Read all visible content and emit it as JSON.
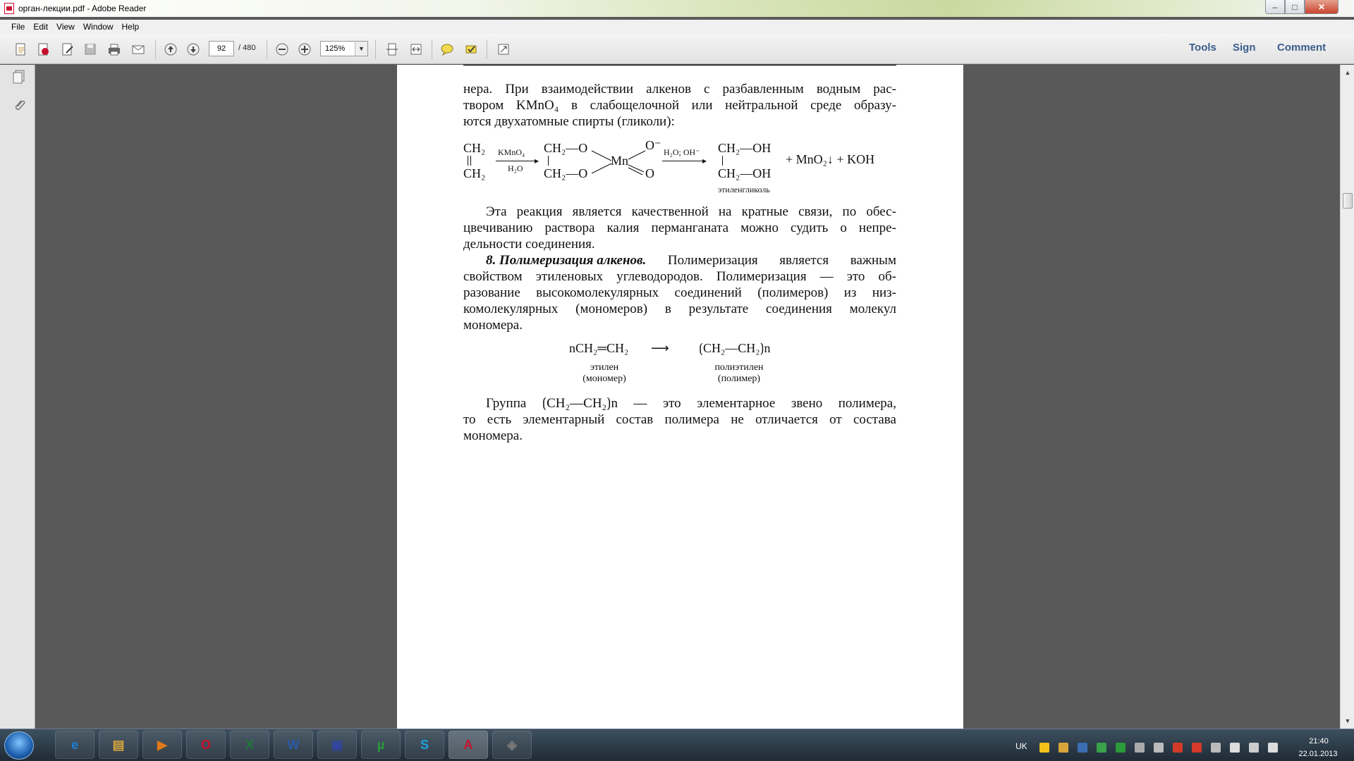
{
  "window": {
    "title": "орган-лекции.pdf - Adobe Reader",
    "minimize": "–",
    "maximize": "□",
    "close": "✕"
  },
  "menu": [
    "File",
    "Edit",
    "View",
    "Window",
    "Help"
  ],
  "toolbar": {
    "page_current": "92",
    "page_total": "/ 480",
    "zoom": "125%",
    "zoom_arrow": "▼",
    "right_buttons": [
      "Tools",
      "Sign",
      "Comment"
    ],
    "icons": [
      "open-icon",
      "create-pdf-icon",
      "edit-icon",
      "save-icon",
      "print-icon",
      "email-icon",
      "page-up-icon",
      "page-down-icon",
      "zoom-out-icon",
      "zoom-in-icon",
      "fit-page-icon",
      "fit-width-icon",
      "comment-icon",
      "highlight-icon",
      "read-mode-icon"
    ]
  },
  "leftpane": {
    "icons": [
      "pages-icon",
      "attachments-icon"
    ]
  },
  "document": {
    "para1": [
      [
        "нера.",
        "При",
        "взаимодействии",
        "алкенов",
        "с",
        "разбавленным",
        "водным",
        "рас-"
      ],
      [
        "твором",
        "KMnO₄",
        "в",
        "слабощелочной",
        "или",
        "нейтральной",
        "среде",
        "образу-"
      ]
    ],
    "para1_last": "ются двухатомные спирты (гликоли):",
    "reaction1": {
      "reactant_top": "CH₂",
      "reactant_bottom": "CH₂",
      "arrow1_top": "KMnO₄",
      "arrow1_bottom": "H₂O",
      "int_top": "CH₂—O",
      "int_bottom": "CH₂—O",
      "mn": "Mn",
      "o_minus": "O⁻",
      "o_double": "O",
      "arrow2_top": "H₂O; OH⁻",
      "prod_top": "CH₂—OH",
      "prod_bottom": "CH₂—OH",
      "byproducts": "+ MnO₂↓ + KOH",
      "prod_label": "этиленгликоль"
    },
    "para2": [
      [
        "Эта",
        "реакция",
        "является",
        "качественной",
        "на",
        "кратные",
        "связи,",
        "по",
        "обес-"
      ],
      [
        "цвечиванию",
        "раствора",
        "калия",
        "перманганата",
        "можно",
        "судить",
        "о",
        "непре-"
      ]
    ],
    "para2_last": "дельности соединения.",
    "para3_heading": "8. Полимеризация алкенов.",
    "para3_first_rest": [
      "Полимеризация",
      "является",
      "важным"
    ],
    "para3": [
      [
        "свойством",
        "этиленовых",
        "углеводородов.",
        "Полимеризация",
        "—",
        "это",
        "об-"
      ],
      [
        "разование",
        "высокомолекулярных",
        "соединений",
        "(полимеров)",
        "из",
        "низ-"
      ],
      [
        "комолекулярных",
        "(мономеров)",
        "в",
        "результате",
        "соединения",
        "молекул"
      ]
    ],
    "para3_last": "мономера.",
    "reaction2": {
      "left": "nCH₂═CH₂",
      "arrow": "⟶",
      "right": "⟮CH₂—CH₂⟯n",
      "left_label1": "этилен",
      "left_label2": "(мономер)",
      "right_label1": "полиэтилен",
      "right_label2": "(полимер)"
    },
    "para4_first": [
      "Группа",
      "⟮CH₂—CH₂⟯n",
      "—",
      "это",
      "элементарное",
      "звено",
      "полимера,"
    ],
    "para4": [
      [
        "то",
        "есть",
        "элементарный",
        "состав",
        "полимера",
        "не",
        "отличается",
        "от",
        "состава"
      ]
    ],
    "para4_last": "мономера."
  },
  "taskbar": {
    "apps": [
      "ie-icon",
      "explorer-icon",
      "media-player-icon",
      "opera-icon",
      "excel-icon",
      "word-icon",
      "save-disk-icon",
      "utorrent-icon",
      "skype-icon",
      "adobe-reader-icon",
      "drive-icon"
    ],
    "app_glyphs": [
      "e",
      "▤",
      "▶",
      "O",
      "X",
      "W",
      "▣",
      "µ",
      "S",
      "A",
      "◈"
    ],
    "lang": "UK",
    "time": "21:40",
    "date": "22.01.2013"
  },
  "colors": {
    "accent": "#3a5c8c",
    "taskbar": "#2a3844",
    "pdf_red": "#c8102e"
  }
}
